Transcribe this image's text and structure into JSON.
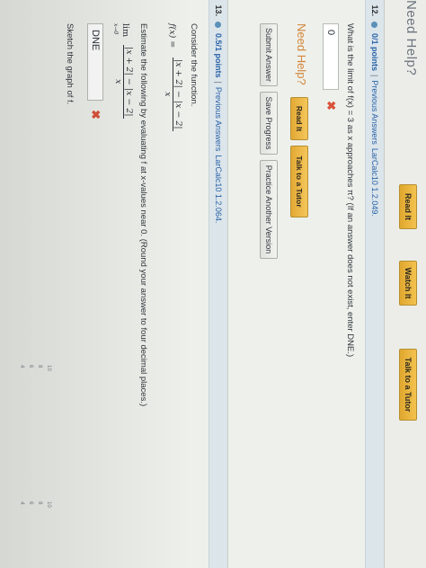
{
  "top": {
    "need_help_cut": "Need Help?",
    "read_it": "Read It",
    "watch_it": "Watch It",
    "talk_tutor": "Talk to a Tutor"
  },
  "q12": {
    "number": "12.",
    "points": "0/1 points",
    "sep": "|",
    "previous_answers": "Previous Answers",
    "ref": "LarCalc10 1.2.049.",
    "question": "What is the limit of f(x) = 3 as x approaches π? (If an answer does not exist, enter DNE.)",
    "answer": "0",
    "x_mark": "✖",
    "need_help": "Need Help?",
    "read_it": "Read It",
    "talk_tutor": "Talk to a Tutor",
    "submit": "Submit Answer",
    "save": "Save Progress",
    "practice": "Practice Another Version"
  },
  "q13": {
    "number": "13.",
    "points": "0.5/1 points",
    "sep": "|",
    "previous_answers": "Previous Answers",
    "ref": "LarCalc10 1.2.064.",
    "consider": "Consider the function.",
    "f_lhs": "f(x) =",
    "f_num": "|x + 2| − |x − 2|",
    "f_den": "x",
    "estimate": "Estimate the following by evaluating f at x-values near 0. (Round your answer to four decimal places.)",
    "lim_word": "lim",
    "lim_sub": "x→0",
    "lim_num": "|x + 2| − |x − 2|",
    "lim_den": "x",
    "answer": "DNE",
    "x_mark": "✖",
    "sketch": "Sketch the graph of f.",
    "ticks_a": [
      "10",
      "8",
      "6",
      "4"
    ],
    "ticks_b": [
      "10",
      "8",
      "6",
      "4"
    ]
  }
}
